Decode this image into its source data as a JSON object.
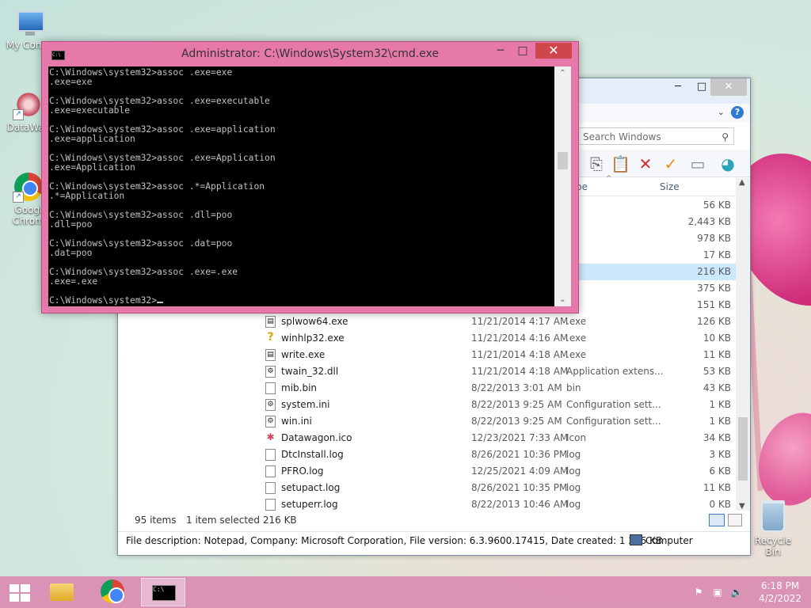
{
  "desktop": {
    "icons": [
      {
        "label": "My Comp"
      },
      {
        "label": "DataWag"
      },
      {
        "label": "Googl Chrom"
      }
    ],
    "recycle_bin": "Recycle Bin"
  },
  "cmd": {
    "title": "Administrator: C:\\Windows\\System32\\cmd.exe",
    "console_text": "C:\\Windows\\system32>assoc .exe=exe\n.exe=exe\n\nC:\\Windows\\system32>assoc .exe=executable\n.exe=executable\n\nC:\\Windows\\system32>assoc .exe=application\n.exe=application\n\nC:\\Windows\\system32>assoc .exe=Application\n.exe=Application\n\nC:\\Windows\\system32>assoc .*=Application\n.*=Application\n\nC:\\Windows\\system32>assoc .dll=poo\n.dll=poo\n\nC:\\Windows\\system32>assoc .dat=poo\n.dat=poo\n\nC:\\Windows\\system32>assoc .exe=.exe\n.exe=.exe\n\n",
    "prompt": "C:\\Windows\\system32>"
  },
  "explorer": {
    "search_placeholder": "Search Windows",
    "column_type": "pe",
    "column_size": "Size",
    "partial_rows": [
      {
        "type": "e",
        "size": "56 KB"
      },
      {
        "type": "e",
        "size": "2,443 KB"
      },
      {
        "type": "e",
        "size": "978 KB"
      },
      {
        "type": "e",
        "size": "17 KB"
      },
      {
        "type": "e",
        "size": "216 KB"
      },
      {
        "type": "e",
        "size": "375 KB"
      },
      {
        "type": "e",
        "size": "151 KB"
      }
    ],
    "rows": [
      {
        "icon": "exe",
        "name": "splwow64.exe",
        "date": "11/21/2014 4:17 AM",
        "type": ".exe",
        "size": "126 KB"
      },
      {
        "icon": "help",
        "name": "winhlp32.exe",
        "date": "11/21/2014 4:16 AM",
        "type": ".exe",
        "size": "10 KB"
      },
      {
        "icon": "exe",
        "name": "write.exe",
        "date": "11/21/2014 4:18 AM",
        "type": ".exe",
        "size": "11 KB"
      },
      {
        "icon": "dll",
        "name": "twain_32.dll",
        "date": "11/21/2014 4:18 AM",
        "type": "Application extens...",
        "size": "53 KB"
      },
      {
        "icon": "file",
        "name": "mib.bin",
        "date": "8/22/2013 3:01 AM",
        "type": "bin",
        "size": "43 KB"
      },
      {
        "icon": "ini",
        "name": "system.ini",
        "date": "8/22/2013 9:25 AM",
        "type": "Configuration sett...",
        "size": "1 KB"
      },
      {
        "icon": "ini",
        "name": "win.ini",
        "date": "8/22/2013 9:25 AM",
        "type": "Configuration sett...",
        "size": "1 KB"
      },
      {
        "icon": "ico",
        "name": "Datawagon.ico",
        "date": "12/23/2021 7:33 AM",
        "type": "Icon",
        "size": "34 KB"
      },
      {
        "icon": "file",
        "name": "DtcInstall.log",
        "date": "8/26/2021 10:36 PM",
        "type": "log",
        "size": "3 KB"
      },
      {
        "icon": "file",
        "name": "PFRO.log",
        "date": "12/25/2021 4:09 AM",
        "type": "log",
        "size": "6 KB"
      },
      {
        "icon": "file",
        "name": "setupact.log",
        "date": "8/26/2021 10:35 PM",
        "type": "log",
        "size": "11 KB"
      },
      {
        "icon": "file",
        "name": "setuperr.log",
        "date": "8/22/2013 10:46 AM",
        "type": "log",
        "size": "0 KB"
      }
    ],
    "status_items": "95 items",
    "status_selected": "1 item selected  216 KB",
    "file_description": "File description: Notepad, Company: Microsoft Corporation, File version: 6.3.9600.17415, Date created: 1 216 KB",
    "location": "Computer"
  },
  "taskbar": {
    "time": "6:18 PM",
    "date": "4/2/2022"
  }
}
